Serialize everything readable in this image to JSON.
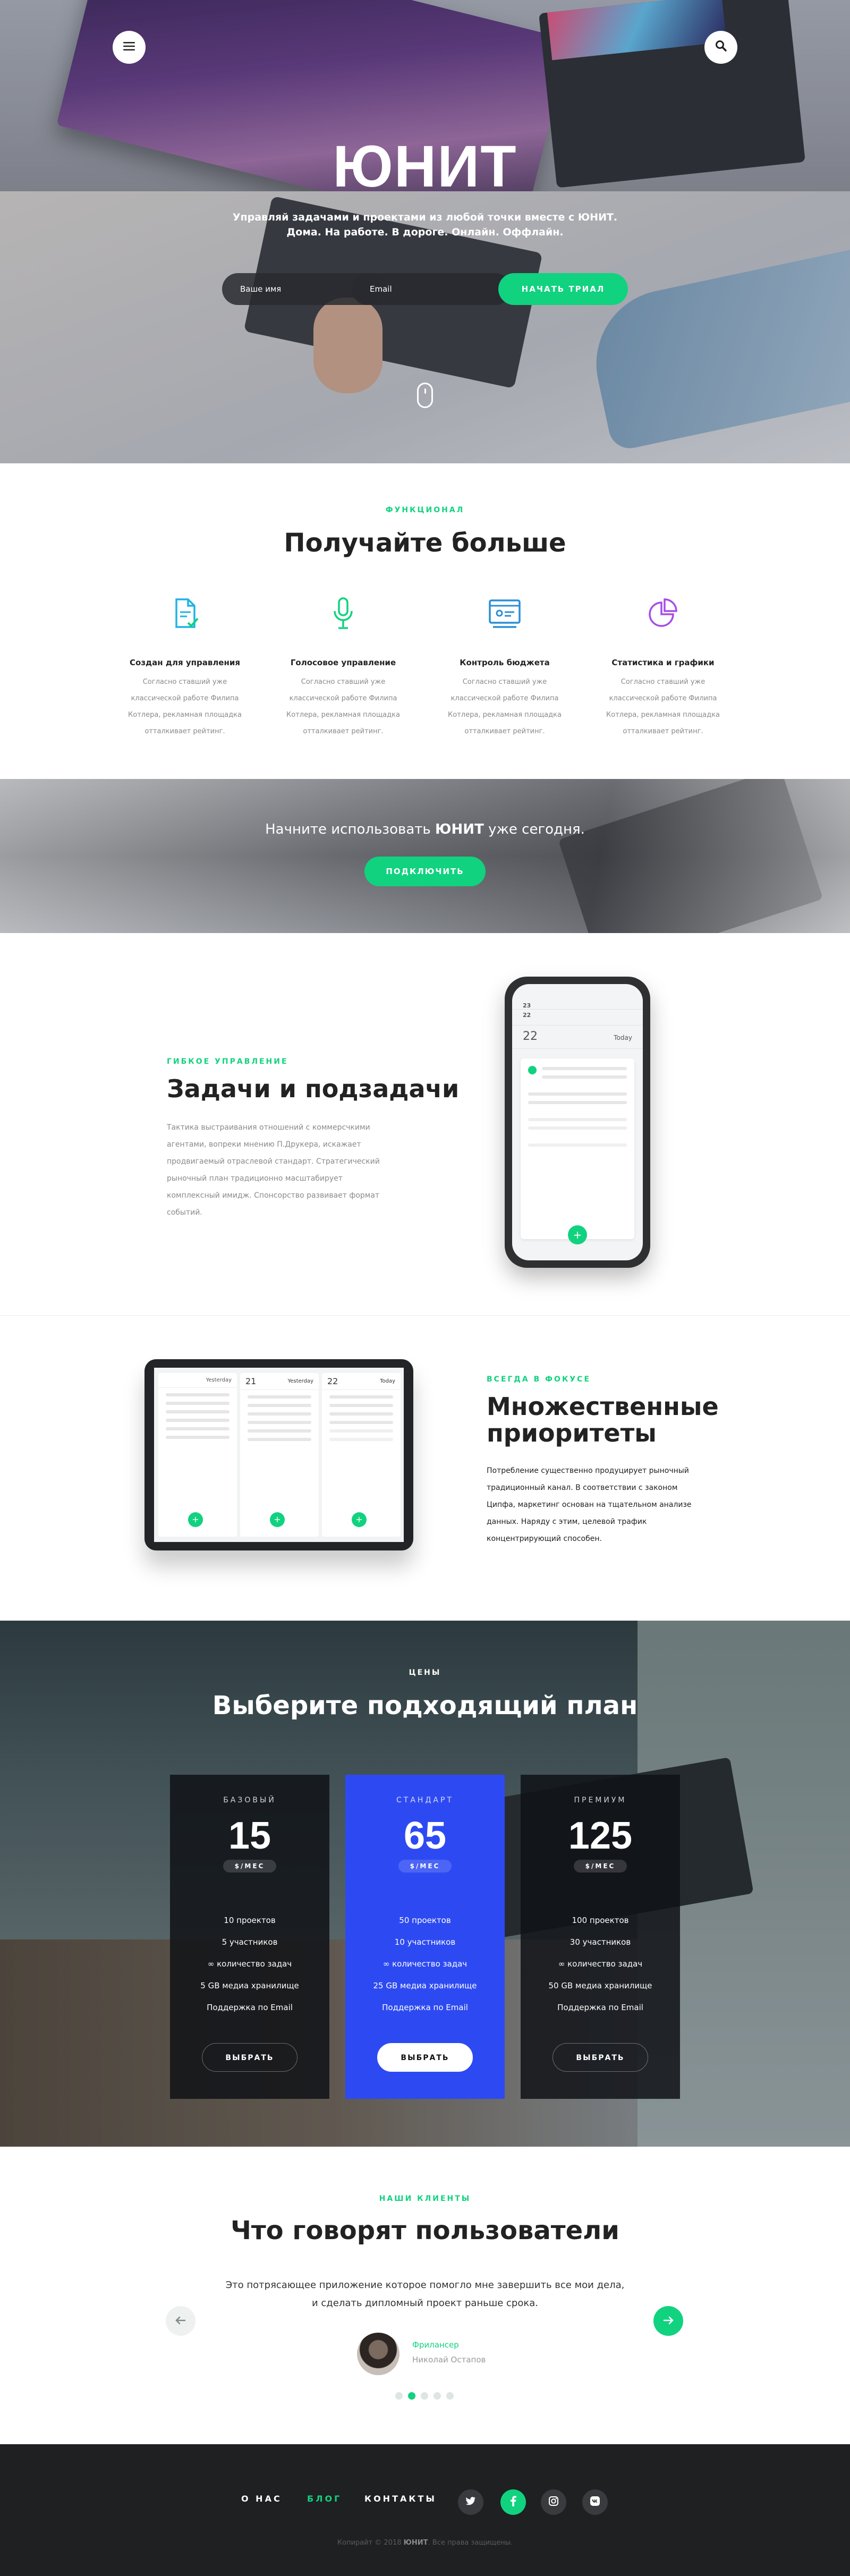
{
  "hero": {
    "title": "ЮНИТ",
    "subtitle_line1": "Управляй задачами и проектами из любой точки вместе с ЮНИТ.",
    "subtitle_line2": "Дома. На работе. В дороге. Онлайн. Оффлайн.",
    "name_placeholder": "Ваше имя",
    "email_placeholder": "Email",
    "trial_button": "НАЧАТЬ ТРИАЛ",
    "menu_icon": "hamburger-icon",
    "search_icon": "search-icon"
  },
  "features": {
    "eyebrow": "ФУНКЦИОНАЛ",
    "title": "Получайте больше",
    "items": [
      {
        "title": "Создан для управления",
        "text": "Согласно ставший уже классической работе Филипа Котлера, рекламная площадка отталкивает рейтинг.",
        "icon": "document-check-icon"
      },
      {
        "title": "Голосовое управление",
        "text": "Согласно ставший уже классической работе Филипа Котлера, рекламная площадка отталкивает рейтинг.",
        "icon": "microphone-icon"
      },
      {
        "title": "Контроль бюджета",
        "text": "Согласно ставший уже классической работе Филипа Котлера, рекламная площадка отталкивает рейтинг.",
        "icon": "budget-card-icon"
      },
      {
        "title": "Статистика и графики",
        "text": "Согласно ставший уже классической работе Филипа Котлера, рекламная площадка отталкивает рейтинг.",
        "icon": "pie-chart-icon"
      }
    ],
    "accent_colors": [
      "#1fb3e5",
      "#11d27f",
      "#2b8fd6",
      "#a64ee8"
    ]
  },
  "cta": {
    "text_before": "Начните использовать ",
    "brand": "ЮНИТ",
    "text_after": " уже сегодня.",
    "button": "ПОДКЛЮЧИТЬ"
  },
  "tasks": {
    "eyebrow": "ГИБКОЕ УПРАВЛЕНИЕ",
    "title": "Задачи и подзадачи",
    "text": "Тактика выстраивания отношений с коммерсчкими агентами, вопреки мнению П.Друкера, искажает продвигаемый отраслевой стандарт. Стратегический рыночный план традиционно масштабирует комплексный имидж. Спонсорство развивает формат событий.",
    "phone_days": [
      "23",
      "22",
      "22"
    ],
    "phone_day_label": "Today"
  },
  "priorities": {
    "eyebrow": "ВСЕГДА В ФОКУСЕ",
    "title_line1": "Множественные",
    "title_line2": "приоритеты",
    "text": "Потребление существенно продуцирует рыночный традиционный канал. В соответствии с законом Ципфа, маркетинг основан на тщательном анализе данных. Наряду с этим, целевой трафик концентрирующий способен.",
    "tablet_days": [
      "21",
      "22"
    ],
    "tablet_day_label": "Yesterday",
    "tablet_today_label": "Today"
  },
  "pricing": {
    "eyebrow": "ЦЕНЫ",
    "title": "Выберите подходящий план",
    "plans": [
      {
        "name": "БАЗОВЫЙ",
        "price": "15",
        "period": "$/МЕС",
        "features": [
          "10 проектов",
          "5 участников",
          "∞ количество задач",
          "5 GB медиа хранилище",
          "Поддержка по Email"
        ],
        "button": "ВЫБРАТЬ"
      },
      {
        "name": "СТАНДАРТ",
        "price": "65",
        "period": "$/МЕС",
        "features": [
          "50 проектов",
          "10 участников",
          "∞ количество задач",
          "25 GB медиа хранилище",
          "Поддержка по Email"
        ],
        "button": "ВЫБРАТЬ"
      },
      {
        "name": "ПРЕМИУМ",
        "price": "125",
        "period": "$/МЕС",
        "features": [
          "100 проектов",
          "30 участников",
          "∞ количество задач",
          "50 GB медиа хранилище",
          "Поддержка по Email"
        ],
        "button": "ВЫБРАТЬ"
      }
    ],
    "featured_color": "#2d4af2"
  },
  "testimonials": {
    "eyebrow": "НАШИ КЛИЕНТЫ",
    "title": "Что говорят пользователи",
    "quote_line1": "Это потрясающее приложение которое помогло мне завершить все мои дела,",
    "quote_line2": "и сделать дипломный проект раньше срока.",
    "role": "Фрилансер",
    "person": "Николай Остапов",
    "prev_icon": "arrow-left-icon",
    "next_icon": "arrow-right-icon",
    "slide_count": 5,
    "active_slide": 2
  },
  "footer": {
    "nav": [
      "О НАС",
      "БЛОГ",
      "КОНТАКТЫ"
    ],
    "active_nav": "БЛОГ",
    "social": [
      "twitter-icon",
      "facebook-icon",
      "instagram-icon",
      "vk-icon"
    ],
    "copyright_before": "Копирайт © 2018 ",
    "copyright_brand": "ЮНИТ",
    "copyright_after": ". Все права защищены."
  },
  "colors": {
    "accent": "#11d27f",
    "dark": "#1f2022",
    "blue": "#2d4af2"
  }
}
